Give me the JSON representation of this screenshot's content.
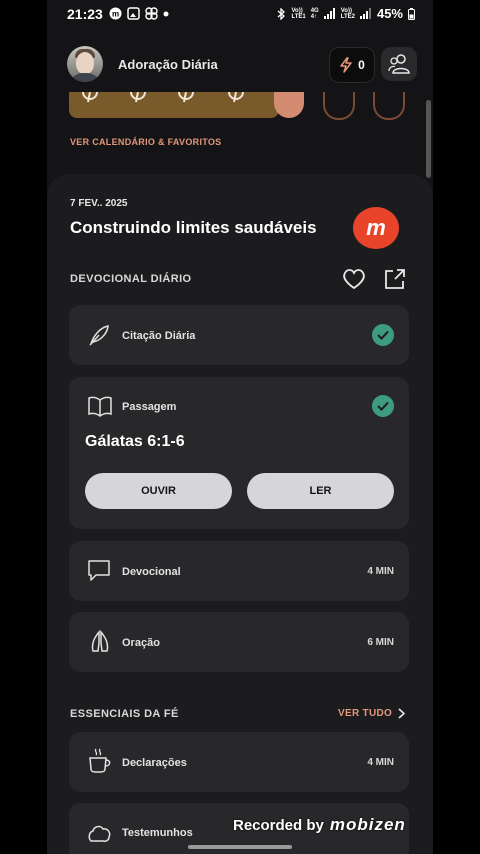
{
  "status_bar": {
    "time": "21:23",
    "network_top": "Vo))",
    "network_bottom": "LTE1",
    "net4g_top": "4G",
    "net4g_bottom": "4↑",
    "network2_top": "Vo))",
    "network2_bottom": "LTE2",
    "battery": "45%"
  },
  "header": {
    "app_title": "Adoração Diária",
    "streak_count": "0"
  },
  "calendar": {
    "link_label": "VER CALENDÁRIO & FAVORITOS"
  },
  "today": {
    "date": "7 FEV.. 2025",
    "title": "Construindo limites saudáveis"
  },
  "devotional_section": {
    "title": "DEVOCIONAL DIÁRIO",
    "quote": {
      "label": "Citação Diária"
    },
    "passage": {
      "label": "Passagem",
      "reference": "Gálatas 6:1-6",
      "listen_label": "OUVIR",
      "read_label": "LER"
    },
    "devotional": {
      "label": "Devocional",
      "duration": "4 MIN"
    },
    "prayer": {
      "label": "Oração",
      "duration": "6 MIN"
    }
  },
  "essentials_section": {
    "title": "ESSENCIAIS DA FÉ",
    "see_all_label": "VER TUDO",
    "declarations": {
      "label": "Declarações",
      "duration": "4 MIN"
    },
    "testimonies": {
      "label": "Testemunhos"
    }
  },
  "overlay": {
    "recording_label": "Recorded by",
    "recording_brand": "mobizen",
    "fab_letter": "m"
  },
  "colors": {
    "background": "#141416",
    "card": "#28282b",
    "accent": "#e3977a",
    "check": "#3d9b7f"
  }
}
